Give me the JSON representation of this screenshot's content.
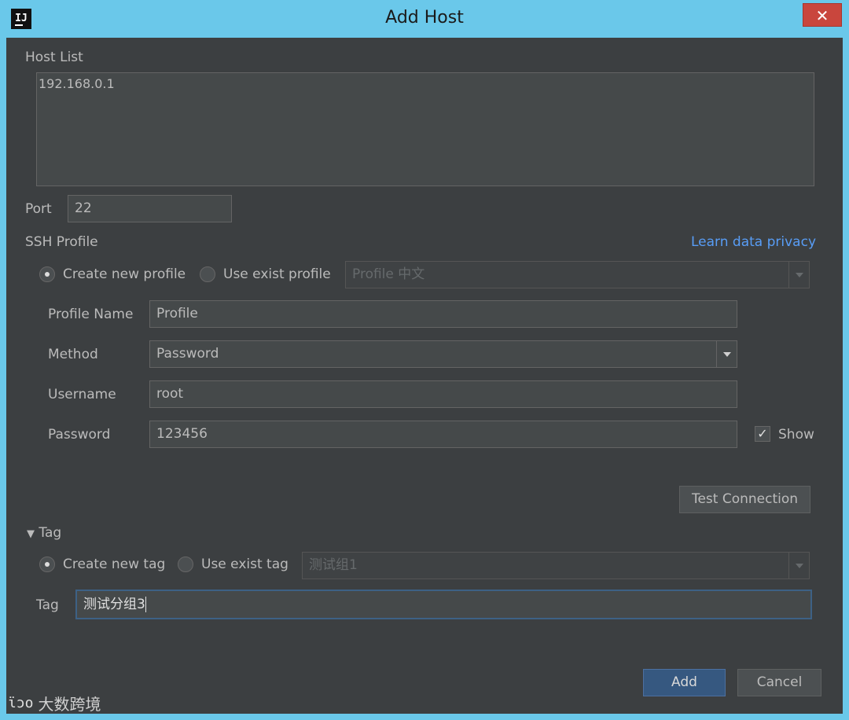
{
  "window": {
    "title": "Add Host",
    "close_label": "✕"
  },
  "host_list": {
    "label": "Host List",
    "value": "192.168.0.1"
  },
  "port": {
    "label": "Port",
    "value": "22"
  },
  "ssh_profile": {
    "section_label": "SSH Profile",
    "privacy_link": "Learn data privacy",
    "create_new_label": "Create new profile",
    "use_exist_label": "Use exist profile",
    "selected_option": "create_new",
    "exist_profile_value": "Profile 中文",
    "profile_name_label": "Profile Name",
    "profile_name_value": "Profile",
    "method_label": "Method",
    "method_value": "Password",
    "username_label": "Username",
    "username_value": "root",
    "password_label": "Password",
    "password_value": "123456",
    "show_label": "Show",
    "show_checked": true,
    "test_connection_label": "Test Connection"
  },
  "tag": {
    "section_label": "Tag",
    "create_new_label": "Create new tag",
    "use_exist_label": "Use exist tag",
    "selected_option": "create_new",
    "exist_tag_value": "测试组1",
    "tag_label": "Tag",
    "tag_value": "测试分组3"
  },
  "footer": {
    "add_label": "Add",
    "cancel_label": "Cancel"
  },
  "watermark": {
    "logo": "ɩ̈ɔo",
    "text": "大数跨境"
  },
  "colors": {
    "titlebar": "#6ac8ea",
    "panel": "#3c3f41",
    "link": "#589df6",
    "close": "#c9463d",
    "primary_button": "#365880"
  }
}
